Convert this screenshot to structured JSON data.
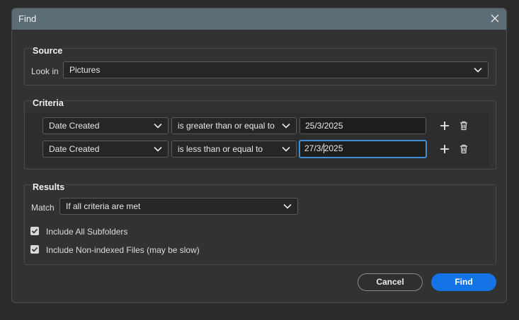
{
  "dialog": {
    "title": "Find"
  },
  "source": {
    "title": "Source",
    "look_in_label": "Look in",
    "look_in_value": "Pictures"
  },
  "criteria": {
    "title": "Criteria",
    "rows": [
      {
        "field": "Date Created",
        "operator": "is greater than or equal to",
        "value": "25/3/2025"
      },
      {
        "field": "Date Created",
        "operator": "is less than or equal to",
        "value_before_caret": "27/3/",
        "value_after_caret": "2025"
      }
    ]
  },
  "results": {
    "title": "Results",
    "match_label": "Match",
    "match_value": "If all criteria are met",
    "include_subfolders": {
      "label": "Include All Subfolders",
      "checked": true
    },
    "include_nonindexed": {
      "label": "Include Non-indexed Files (may be slow)",
      "checked": true
    }
  },
  "buttons": {
    "cancel": "Cancel",
    "find": "Find"
  },
  "colors": {
    "accent": "#1473e6",
    "titlebar": "#5b6c74",
    "focus": "#3f8fd8"
  }
}
